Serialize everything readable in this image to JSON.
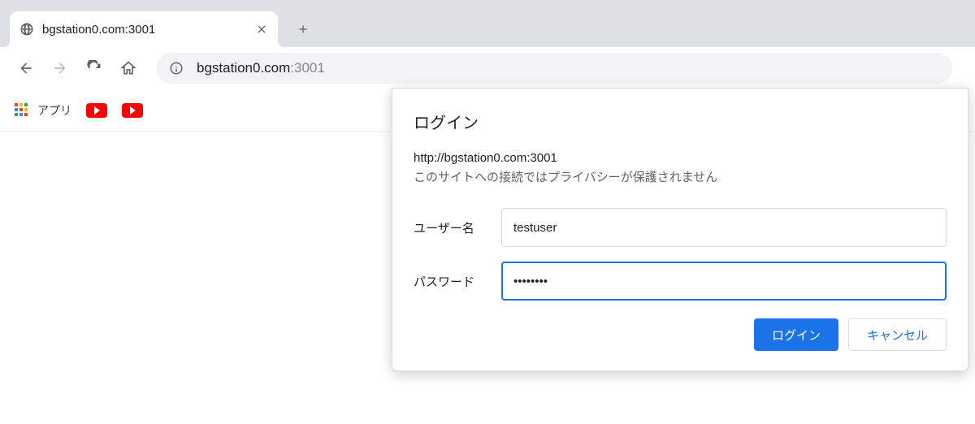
{
  "tab": {
    "title": "bgstation0.com:3001"
  },
  "address": {
    "host": "bgstation0.com",
    "port": ":3001"
  },
  "bookmarks": {
    "apps_label": "アプリ"
  },
  "dialog": {
    "title": "ログイン",
    "origin": "http://bgstation0.com:3001",
    "warning": "このサイトへの接続ではプライバシーが保護されません",
    "username_label": "ユーザー名",
    "username_value": "testuser",
    "password_label": "パスワード",
    "password_value": "••••••••",
    "login_button": "ログイン",
    "cancel_button": "キャンセル"
  }
}
